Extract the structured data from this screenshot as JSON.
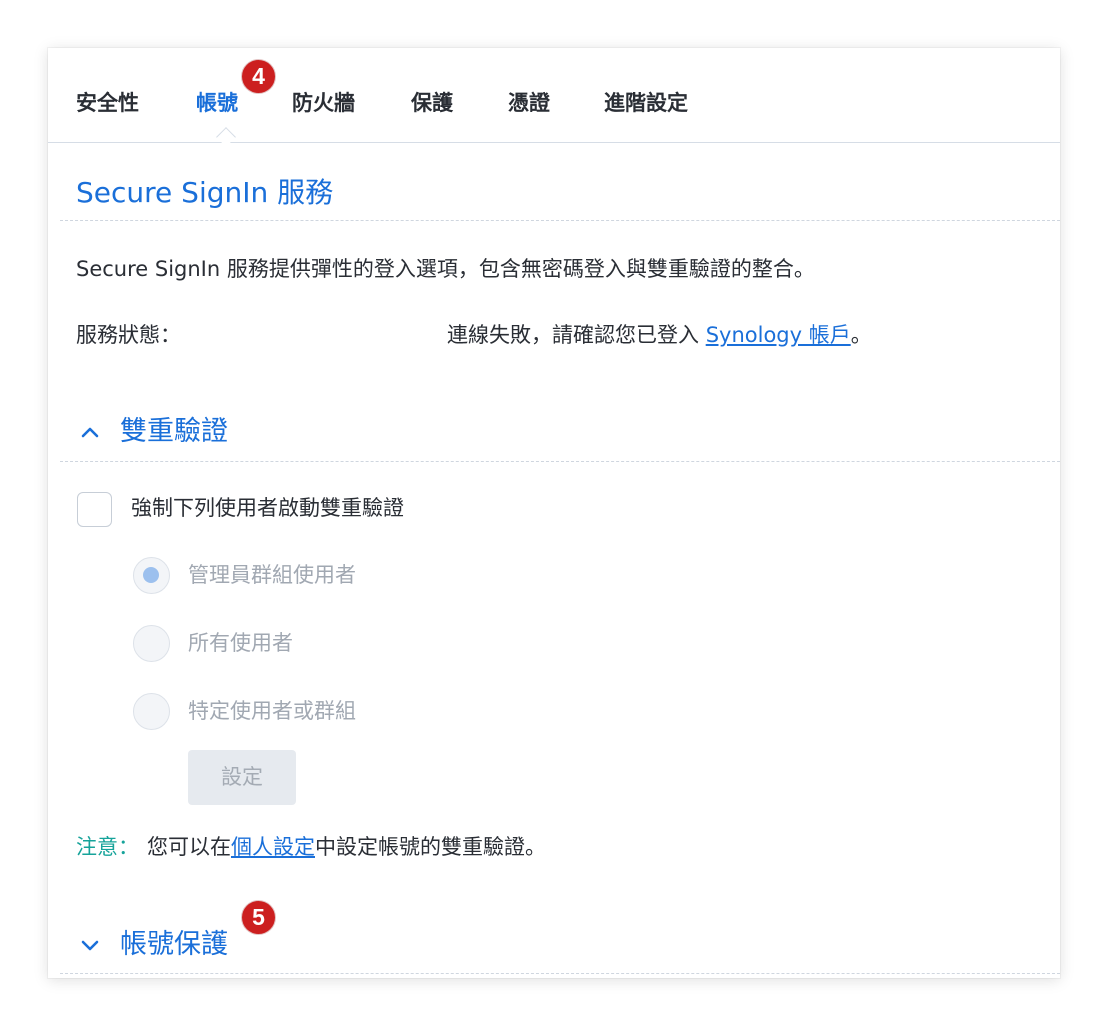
{
  "tabs": [
    {
      "label": "安全性"
    },
    {
      "label": "帳號"
    },
    {
      "label": "防火牆"
    },
    {
      "label": "保護"
    },
    {
      "label": "憑證"
    },
    {
      "label": "進階設定"
    }
  ],
  "active_tab": "帳號",
  "badges": {
    "tab_badge": "4",
    "section_badge": "5"
  },
  "secure_signin": {
    "title": "Secure SignIn 服務",
    "description": "Secure SignIn 服務提供彈性的登入選項，包含無密碼登入與雙重驗證的整合。",
    "status_label": "服務狀態：",
    "status_text": "連線失敗，請確認您已登入 ",
    "status_link": "Synology 帳戶",
    "status_suffix": "。"
  },
  "two_factor": {
    "title": "雙重驗證",
    "expanded": true,
    "enforce_label": "強制下列使用者啟動雙重驗證",
    "enforce_checked": false,
    "options": [
      {
        "label": "管理員群組使用者",
        "selected": true
      },
      {
        "label": "所有使用者",
        "selected": false
      },
      {
        "label": "特定使用者或群組",
        "selected": false
      }
    ],
    "settings_button": "設定",
    "note_label": "注意：",
    "note_text_before": "您可以在",
    "note_link": "個人設定",
    "note_text_after": "中設定帳號的雙重驗證。"
  },
  "account_protection": {
    "title": "帳號保護",
    "expanded": false
  },
  "colors": {
    "accent": "#1a6fd9",
    "badge": "#cc1f1f",
    "note": "#16a39a"
  },
  "icons": {
    "expanded": "chevron-up-icon",
    "collapsed": "chevron-down-icon"
  }
}
